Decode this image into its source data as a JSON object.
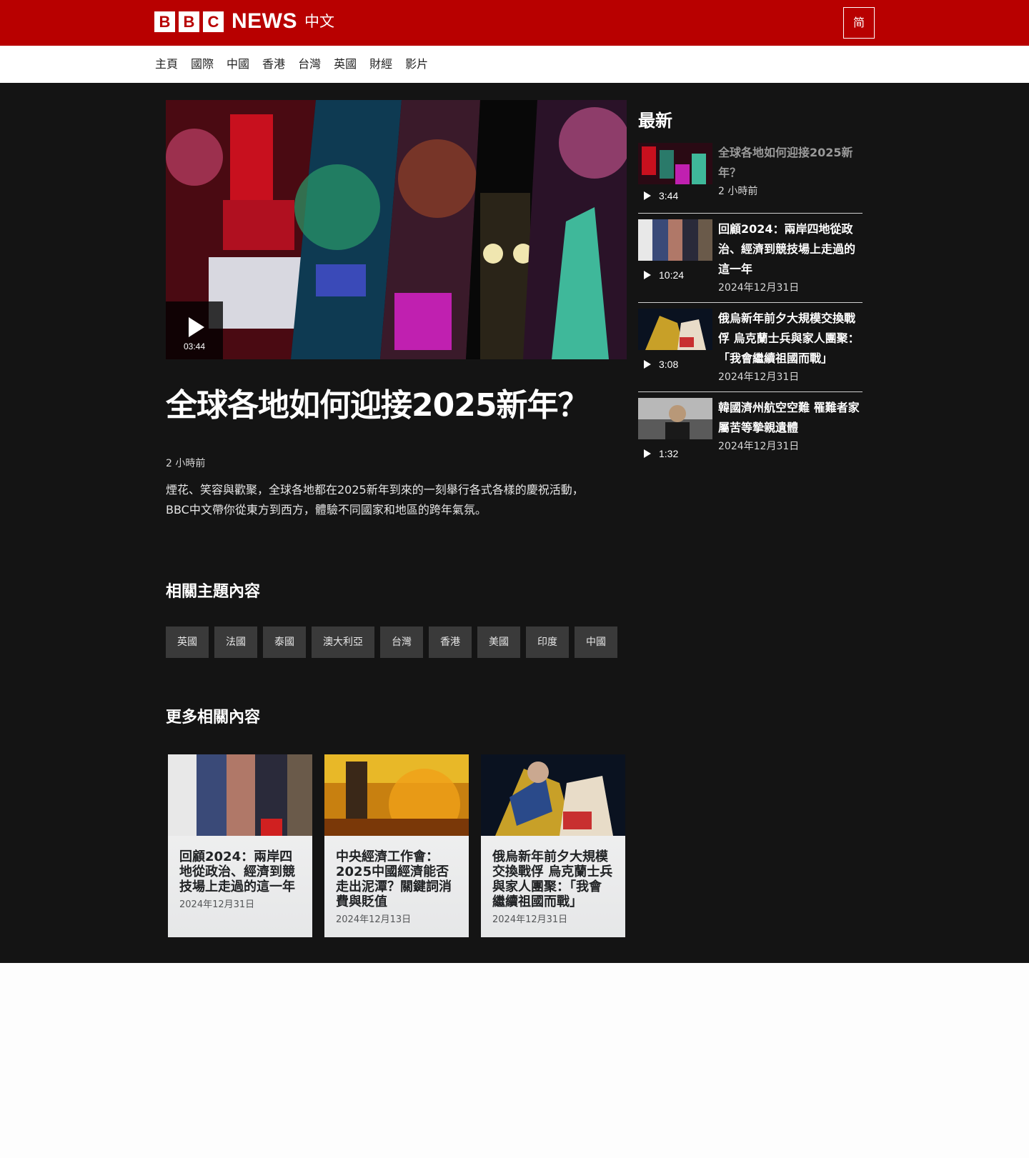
{
  "header": {
    "brand_letters": [
      "B",
      "B",
      "C"
    ],
    "brand_news": "NEWS",
    "brand_edition": "中文",
    "lang_toggle": "简"
  },
  "nav": {
    "items": [
      "主頁",
      "國際",
      "中國",
      "香港",
      "台灣",
      "英國",
      "財經",
      "影片"
    ]
  },
  "video": {
    "duration": "03:44"
  },
  "article": {
    "headline": "全球各地如何迎接2025新年？",
    "timestamp": "2 小時前",
    "summary": "煙花、笑容與歡聚，全球各地都在2025新年到來的一刻舉行各式各樣的慶祝活動，BBC中文帶你從東方到西方，體驗不同國家和地區的跨年氣氛。"
  },
  "related_topics": {
    "title": "相關主題內容",
    "tags": [
      "英國",
      "法國",
      "泰國",
      "澳大利亞",
      "台灣",
      "香港",
      "美國",
      "印度",
      "中國"
    ]
  },
  "more_related": {
    "title": "更多相關內容",
    "cards": [
      {
        "title": "回顧2024：兩岸四地從政治、經濟到競技場上走過的這一年",
        "date": "2024年12月31日"
      },
      {
        "title": "中央經濟工作會：2025中國經濟能否走出泥潭？關鍵詞消費與貶值",
        "date": "2024年12月13日"
      },
      {
        "title": "俄烏新年前夕大規模交換戰俘 烏克蘭士兵與家人團聚：「我會繼續祖國而戰」",
        "date": "2024年12月31日"
      }
    ]
  },
  "latest": {
    "title": "最新",
    "items": [
      {
        "title": "全球各地如何迎接2025新年？",
        "duration": "3:44",
        "date": "2 小時前"
      },
      {
        "title": "回顧2024：兩岸四地從政治、經濟到競技場上走過的這一年",
        "duration": "10:24",
        "date": "2024年12月31日"
      },
      {
        "title": "俄烏新年前夕大規模交換戰俘 烏克蘭士兵與家人團聚：「我會繼續祖國而戰」",
        "duration": "3:08",
        "date": "2024年12月31日"
      },
      {
        "title": "韓國濟州航空空難 罹難者家屬苦等摯親遺體",
        "duration": "1:32",
        "date": "2024年12月31日"
      }
    ]
  },
  "colors": {
    "brand_red": "#b80000",
    "dark_bg": "#141414",
    "tag_bg": "#3a3a3a"
  }
}
